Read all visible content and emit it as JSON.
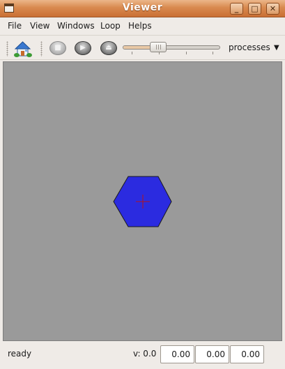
{
  "window": {
    "title": "Viewer",
    "controls": {
      "minimize": "_",
      "maximize": "□",
      "close": "✕"
    }
  },
  "menu": {
    "items": [
      {
        "label": "File"
      },
      {
        "label": "View"
      },
      {
        "label": "Windows"
      },
      {
        "label": "Loop"
      },
      {
        "label": "Helps"
      }
    ]
  },
  "toolbar": {
    "home_icon": "home-icon",
    "stop_icon": "stop-icon",
    "play_icon": "play-icon",
    "step_icon": "step-icon",
    "slider_value_fraction": 0.36,
    "processes_label": "processes",
    "dropdown_icon": "chevron-down-icon"
  },
  "canvas": {
    "background": "#9a9a9a",
    "shape": {
      "type": "hexagon",
      "fill": "#2b2be0",
      "stroke": "#1a1a1a",
      "marker_color": "#b0141e"
    }
  },
  "status": {
    "text": "ready",
    "v_label": "v: 0.0",
    "fields": [
      "0.00",
      "0.00",
      "0.00"
    ]
  },
  "colors": {
    "titlebar_accent": "#d98a4f",
    "window_bg": "#efebe7"
  }
}
